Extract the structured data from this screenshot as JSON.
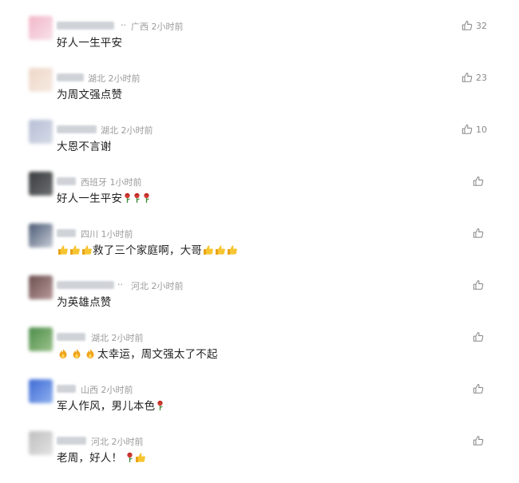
{
  "comments": [
    {
      "location": "广西",
      "time": "2小时前",
      "text": "好人一生平安",
      "likes": "32",
      "avatar_colors": [
        "#f2b6c8",
        "#f7e1ea"
      ],
      "name_ellipsis": ".."
    },
    {
      "location": "湖北",
      "time": "2小时前",
      "text": "为周文强点赞",
      "likes": "23",
      "avatar_colors": [
        "#efd7c8",
        "#f6ebe3"
      ],
      "name_ellipsis": ""
    },
    {
      "location": "湖北",
      "time": "2小时前",
      "text": "大恩不言谢",
      "likes": "10",
      "avatar_colors": [
        "#b7bfd6",
        "#d6dbe7"
      ],
      "name_ellipsis": ""
    },
    {
      "location": "西班牙",
      "time": "1小时前",
      "text": "好人一生平安",
      "likes": "",
      "avatar_colors": [
        "#3a3d3f",
        "#6c6e70"
      ],
      "name_ellipsis": ""
    },
    {
      "location": "四川",
      "time": "1小时前",
      "text": "救了三个家庭啊，大哥",
      "likes": "",
      "avatar_colors": [
        "#4b5a75",
        "#c7ccd6"
      ],
      "name_ellipsis": ""
    },
    {
      "location": "河北",
      "time": "2小时前",
      "text": "为英雄点赞",
      "likes": "",
      "avatar_colors": [
        "#6b4e4e",
        "#b99a9a"
      ],
      "name_ellipsis": ".."
    },
    {
      "location": "湖北",
      "time": "2小时前",
      "text": "太幸运，周文强太了不起",
      "likes": "",
      "avatar_colors": [
        "#4c8c4a",
        "#9cc38c"
      ],
      "name_ellipsis": ""
    },
    {
      "location": "山西",
      "time": "2小时前",
      "text": "军人作风，男儿本色",
      "likes": "",
      "avatar_colors": [
        "#3e6bd6",
        "#8fb0ee"
      ],
      "name_ellipsis": ""
    },
    {
      "location": "河北",
      "time": "2小时前",
      "text": "老周，好人！",
      "likes": "",
      "avatar_colors": [
        "#bfbfbf",
        "#e3e3e3"
      ],
      "name_ellipsis": ""
    }
  ],
  "icons": {
    "like": "thumbs-up-outline-icon",
    "rose": "rose-emoji-icon",
    "thumbs_emoji": "thumbs-up-emoji-icon"
  },
  "colors": {
    "meta_text": "#9b9b9b",
    "comment_text": "#222222",
    "like_icon": "#8a8a8a"
  }
}
